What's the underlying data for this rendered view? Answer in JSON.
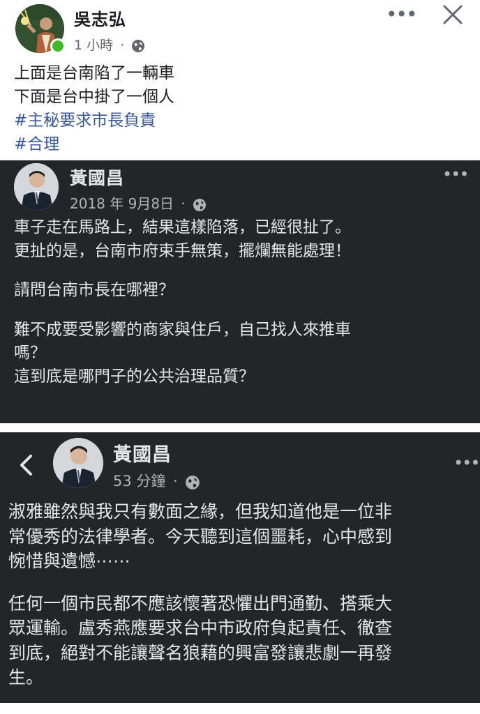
{
  "post": {
    "author": "吳志弘",
    "time": "1 小時",
    "separator": "·",
    "lines": [
      "上面是台南陷了一輛車",
      "下面是台中掛了一個人"
    ],
    "hashtags": [
      "#主秘要求市長負責",
      "#合理"
    ]
  },
  "screenshot1": {
    "author": "黃國昌",
    "date": "2018 年 9月8日",
    "separator": "·",
    "lines": [
      "車子走在馬路上，結果這樣陷落，已經很扯了。",
      "更扯的是，台南市府束手無策，擺爛無能處理！",
      "",
      "請問台南市長在哪裡？",
      "",
      "難不成要受影響的商家與住戶，自己找人來推車",
      "嗎？",
      "這到底是哪門子的公共治理品質？"
    ]
  },
  "screenshot2": {
    "author": "黃國昌",
    "time": "53 分鐘",
    "separator": "·",
    "lines": [
      "淑雅雖然與我只有數面之緣，但我知道他是一位非",
      "常優秀的法律學者。今天聽到這個噩耗，心中感到",
      "惋惜與遺憾⋯⋯",
      "",
      "任何一個市民都不應該懷著恐懼出門通勤、搭乘大",
      "眾運輸。盧秀燕應要求台中市政府負起責任、徹查",
      "到底，絕對不能讓聲名狼藉的興富發讓悲劇一再發",
      "生。"
    ]
  },
  "icons": {
    "more": "more-horizontal-icon",
    "close": "close-icon",
    "privacy": "globe-icon",
    "back": "chevron-left-icon"
  },
  "colors": {
    "hashtag": "#385898",
    "online": "#42b72a",
    "dark_bg": "#242526"
  }
}
